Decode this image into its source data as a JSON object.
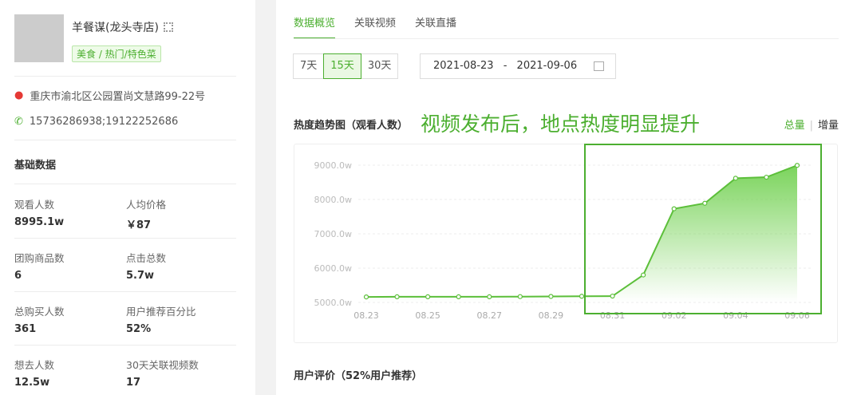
{
  "shop": {
    "name": "羊餐谋(龙头寺店)",
    "tag": "美食 / 热门/特色菜",
    "address": "重庆市渝北区公园置尚文慧路99-22号",
    "phone": "15736286938;19122252686"
  },
  "basic": {
    "title": "基础数据",
    "stats": [
      {
        "label": "观看人数",
        "value": "8995.1w"
      },
      {
        "label": "人均价格",
        "value": "￥87"
      },
      {
        "label": "团购商品数",
        "value": "6"
      },
      {
        "label": "点击总数",
        "value": "5.7w"
      },
      {
        "label": "总购买人数",
        "value": "361"
      },
      {
        "label": "用户推荐百分比",
        "value": "52%"
      },
      {
        "label": "想去人数",
        "value": "12.5w"
      },
      {
        "label": "30天关联视频数",
        "value": "17"
      }
    ]
  },
  "tabs": [
    "数据概览",
    "关联视频",
    "关联直播"
  ],
  "ranges": [
    "7天",
    "15天",
    "30天"
  ],
  "date_range": {
    "start": "2021-08-23",
    "sep": "-",
    "end": "2021-09-06"
  },
  "chart_title": "热度趋势图（观看人数）",
  "annotation": "视频发布后，地点热度明显提升",
  "modes": [
    "总量",
    "增量"
  ],
  "eval_title": "用户评价（52%用户推荐）",
  "colors": {
    "accent": "#4caf30"
  },
  "chart_data": {
    "type": "area",
    "title": "热度趋势图（观看人数）",
    "x": [
      "08.23",
      "08.24",
      "08.25",
      "08.26",
      "08.27",
      "08.28",
      "08.29",
      "08.30",
      "08.31",
      "09.01",
      "09.02",
      "09.03",
      "09.04",
      "09.05",
      "09.06"
    ],
    "values": [
      5160,
      5165,
      5165,
      5165,
      5165,
      5170,
      5175,
      5180,
      5185,
      5800,
      7730,
      7890,
      8620,
      8650,
      8995
    ],
    "x_tick_labels": [
      "08.23",
      "08.25",
      "08.27",
      "08.29",
      "08.31",
      "09.02",
      "09.04",
      "09.06"
    ],
    "y_tick_labels": [
      "5000.0w",
      "6000.0w",
      "7000.0w",
      "8000.0w",
      "9000.0w"
    ],
    "ylim": [
      5000,
      9000
    ],
    "unit": "w"
  }
}
